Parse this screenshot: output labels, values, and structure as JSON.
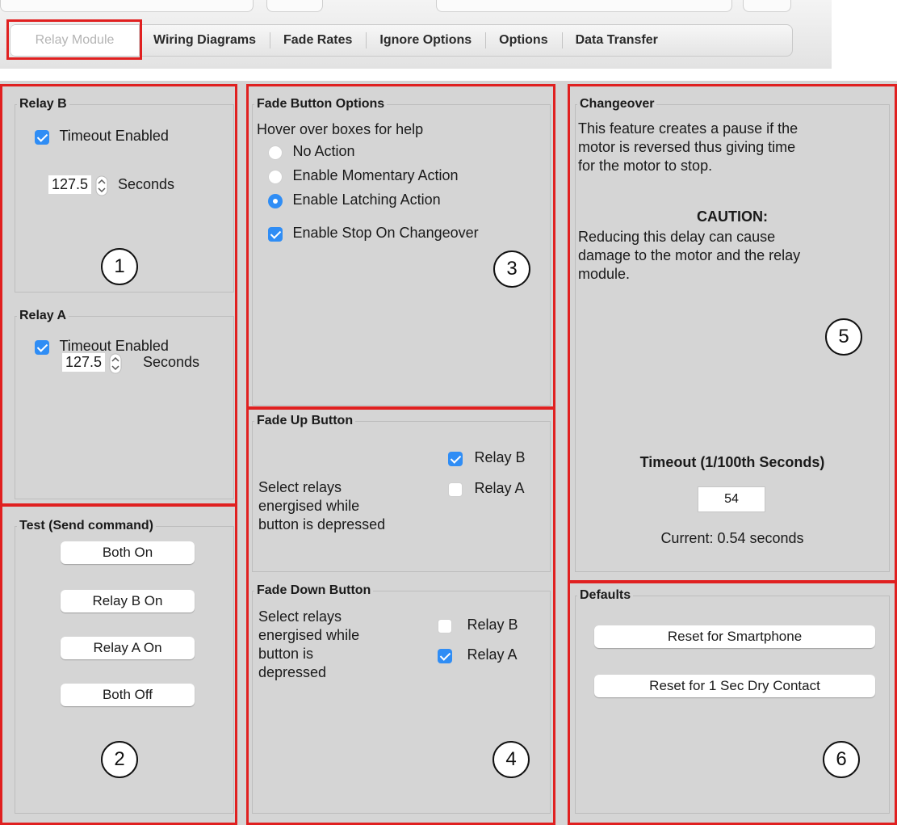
{
  "tabs": [
    "Relay Module",
    "Wiring Diagrams",
    "Fade Rates",
    "Ignore Options",
    "Options",
    "Data Transfer"
  ],
  "relay_b": {
    "title": "Relay B",
    "timeout_label": "Timeout Enabled",
    "timeout_checked": true,
    "value": "127.5",
    "unit": "Seconds"
  },
  "relay_a": {
    "title": "Relay A",
    "timeout_label": "Timeout Enabled",
    "timeout_checked": true,
    "value": "127.5",
    "unit": "Seconds"
  },
  "test": {
    "title": "Test (Send command)",
    "buttons": [
      "Both On",
      "Relay B On",
      "Relay A On",
      "Both Off"
    ]
  },
  "fade_button_options": {
    "title": "Fade Button Options",
    "hint": "Hover over boxes for help",
    "options": [
      "No Action",
      "Enable Momentary Action",
      "Enable Latching Action"
    ],
    "selected": "Enable Latching Action",
    "stop_label": "Enable Stop On Changeover"
  },
  "fade_up": {
    "title": "Fade Up Button",
    "relay_b": "Relay B",
    "relay_a": "Relay A",
    "line1": "Select relays",
    "line2": "energised while",
    "line3": "button is depressed"
  },
  "fade_down": {
    "title": "Fade Down Button",
    "relay_b": "Relay B",
    "relay_a": "Relay A",
    "line1": "Select relays",
    "line2": "energised while",
    "line3": "button is",
    "line4": "depressed"
  },
  "changeover": {
    "title": "Changeover",
    "desc1": "This feature creates a pause if the",
    "desc2": "motor is reversed thus giving time",
    "desc3": "for the motor to stop.",
    "caution": "CAUTION:",
    "warn1": "Reducing this delay can cause",
    "warn2": "damage to the motor and the relay",
    "warn3": "module.",
    "timeout_label": "Timeout (1/100th Seconds)",
    "timeout_value": "54",
    "current": "Current: 0.54 seconds"
  },
  "defaults": {
    "title": "Defaults",
    "btn1": "Reset for Smartphone",
    "btn2": "Reset for 1 Sec Dry Contact"
  },
  "markers": [
    "1",
    "2",
    "3",
    "4",
    "5",
    "6"
  ]
}
